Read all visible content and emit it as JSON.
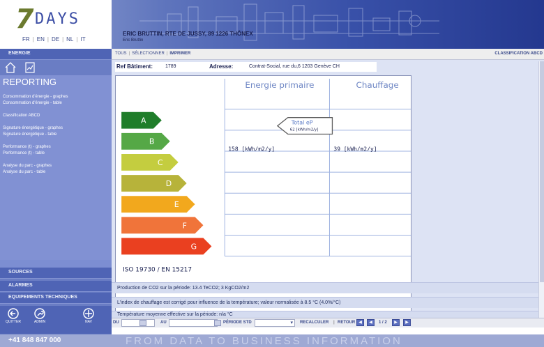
{
  "header": {
    "logo": {
      "seven": "7",
      "days": "DAYS"
    },
    "languages": [
      "FR",
      "EN",
      "DE",
      "NL",
      "IT"
    ],
    "address": "ERIC BRUTTIN, RTE DE JUSSY, 89 1226 THÔNEX",
    "user": "Eric Bruttin"
  },
  "sidebar": {
    "section_energie": "ENERGIE",
    "home_icon": "home-icon",
    "report_icon": "chart-report-icon",
    "reporting_title": "REPORTING",
    "reporting_links": [
      "Consommation d'énergie - graphes",
      "Consommation d'énergie - table",
      "Classification ABCD",
      "Signature énergétique - graphes",
      "Signature énergétique - table",
      "Performance (t) - graphes",
      "Performance (t) - table",
      "Analyse du parc - graphes",
      "Analyse du parc - table"
    ],
    "section_sources": "SOURCES",
    "section_alarmes": "ALARMES",
    "section_equipements": "EQUIPEMENTS TECHNIQUES",
    "nav_buttons": [
      {
        "label": "QUITTER",
        "icon": "quit-arrow-icon"
      },
      {
        "label": "ADMIN",
        "icon": "admin-wrench-icon"
      },
      {
        "label": "NAV",
        "icon": "nav-compass-icon"
      }
    ]
  },
  "toolbar": {
    "tous": "TOUS",
    "selectionner": "SÉLECTIONNER",
    "imprimer": "IMPRIMER",
    "right_title": "CLASSIFICATION ABCD"
  },
  "building": {
    "ref_label": "Ref Bâtiment:",
    "ref_value": "1789",
    "address_label": "Adresse:",
    "address_value": "Contrat-Social, rue du,6 1203 Genève CH"
  },
  "chart_data": {
    "type": "table",
    "columns": [
      "Energie primaire",
      "Chauffage"
    ],
    "classes": [
      "A",
      "B",
      "C",
      "D",
      "E",
      "F",
      "G"
    ],
    "class_colors": [
      "#1f7d2a",
      "#55a846",
      "#c4cd3f",
      "#b7b33a",
      "#f2a81d",
      "#f0743a",
      "#ea4020"
    ],
    "marker": {
      "title": "Total eP",
      "value": "62 [kWh/m2/y]",
      "class": "A"
    },
    "values": {
      "energie_primaire": "158 [kWh/m2/y]",
      "chauffage": "39 [kWh/m2/y]"
    },
    "standard": "ISO 19730 / EN 15217"
  },
  "messages": {
    "co2": "Production de CO2 sur la période: 13.4 TeCO2; 3 KgCO2/m2",
    "index": "L'index de chauffage est corrigé pour influence de la température; valeur normalisée à 8.5 °C (4.0%/°C)",
    "temp": "Température moyenne effective sur la période: n/a °C"
  },
  "bottom_bar": {
    "du": "DU",
    "au": "AU",
    "periode": "PÉRIODE STD",
    "recalculer": "RECALCULER",
    "retour": "RETOUR",
    "page": "1 / 2"
  },
  "footer": {
    "phone": "+41 848 847 000",
    "slogan": "FROM DATA TO BUSINESS INFORMATION"
  }
}
